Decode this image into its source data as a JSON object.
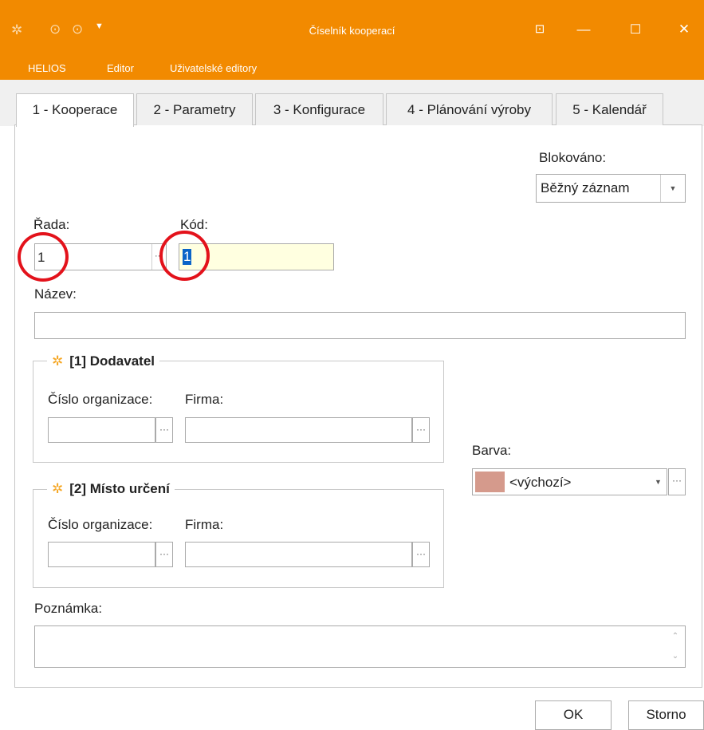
{
  "window": {
    "title": "Číselník kooperací",
    "app_icon": "helios-icon",
    "controls": [
      "pin-icon",
      "minimize-icon",
      "maximize-icon",
      "close-icon"
    ]
  },
  "menu": {
    "items": [
      "HELIOS",
      "Editor",
      "Uživatelské editory"
    ]
  },
  "tabs": [
    {
      "label": "1 - Kooperace",
      "active": true
    },
    {
      "label": "2 - Parametry",
      "active": false
    },
    {
      "label": "3 - Konfigurace",
      "active": false
    },
    {
      "label": "4 - Plánování výroby",
      "active": false
    },
    {
      "label": "5 - Kalendář",
      "active": false
    }
  ],
  "form": {
    "blokovano": {
      "label": "Blokováno:",
      "value": "Běžný záznam"
    },
    "rada": {
      "label": "Řada:",
      "value": "1"
    },
    "kod": {
      "label": "Kód:",
      "value": "1"
    },
    "nazev": {
      "label": "Název:",
      "value": ""
    },
    "dodavatel": {
      "title": "[1] Dodavatel",
      "cislo_label": "Číslo organizace:",
      "firma_label": "Firma:"
    },
    "misto_urceni": {
      "title": "[2] Místo určení",
      "cislo_label": "Číslo organizace:",
      "firma_label": "Firma:"
    },
    "barva": {
      "label": "Barva:",
      "value": "<výchozí>",
      "swatch_color": "#d59a8c"
    },
    "poznamka": {
      "label": "Poznámka:",
      "value": ""
    },
    "ellipsis": "···"
  },
  "buttons": {
    "ok": "OK",
    "storno": "Storno"
  },
  "colors": {
    "titlebar": "#f28a00",
    "highlight": "#0a64c8",
    "annotation": "#e3121b",
    "kod_bg": "#ffffe0"
  }
}
